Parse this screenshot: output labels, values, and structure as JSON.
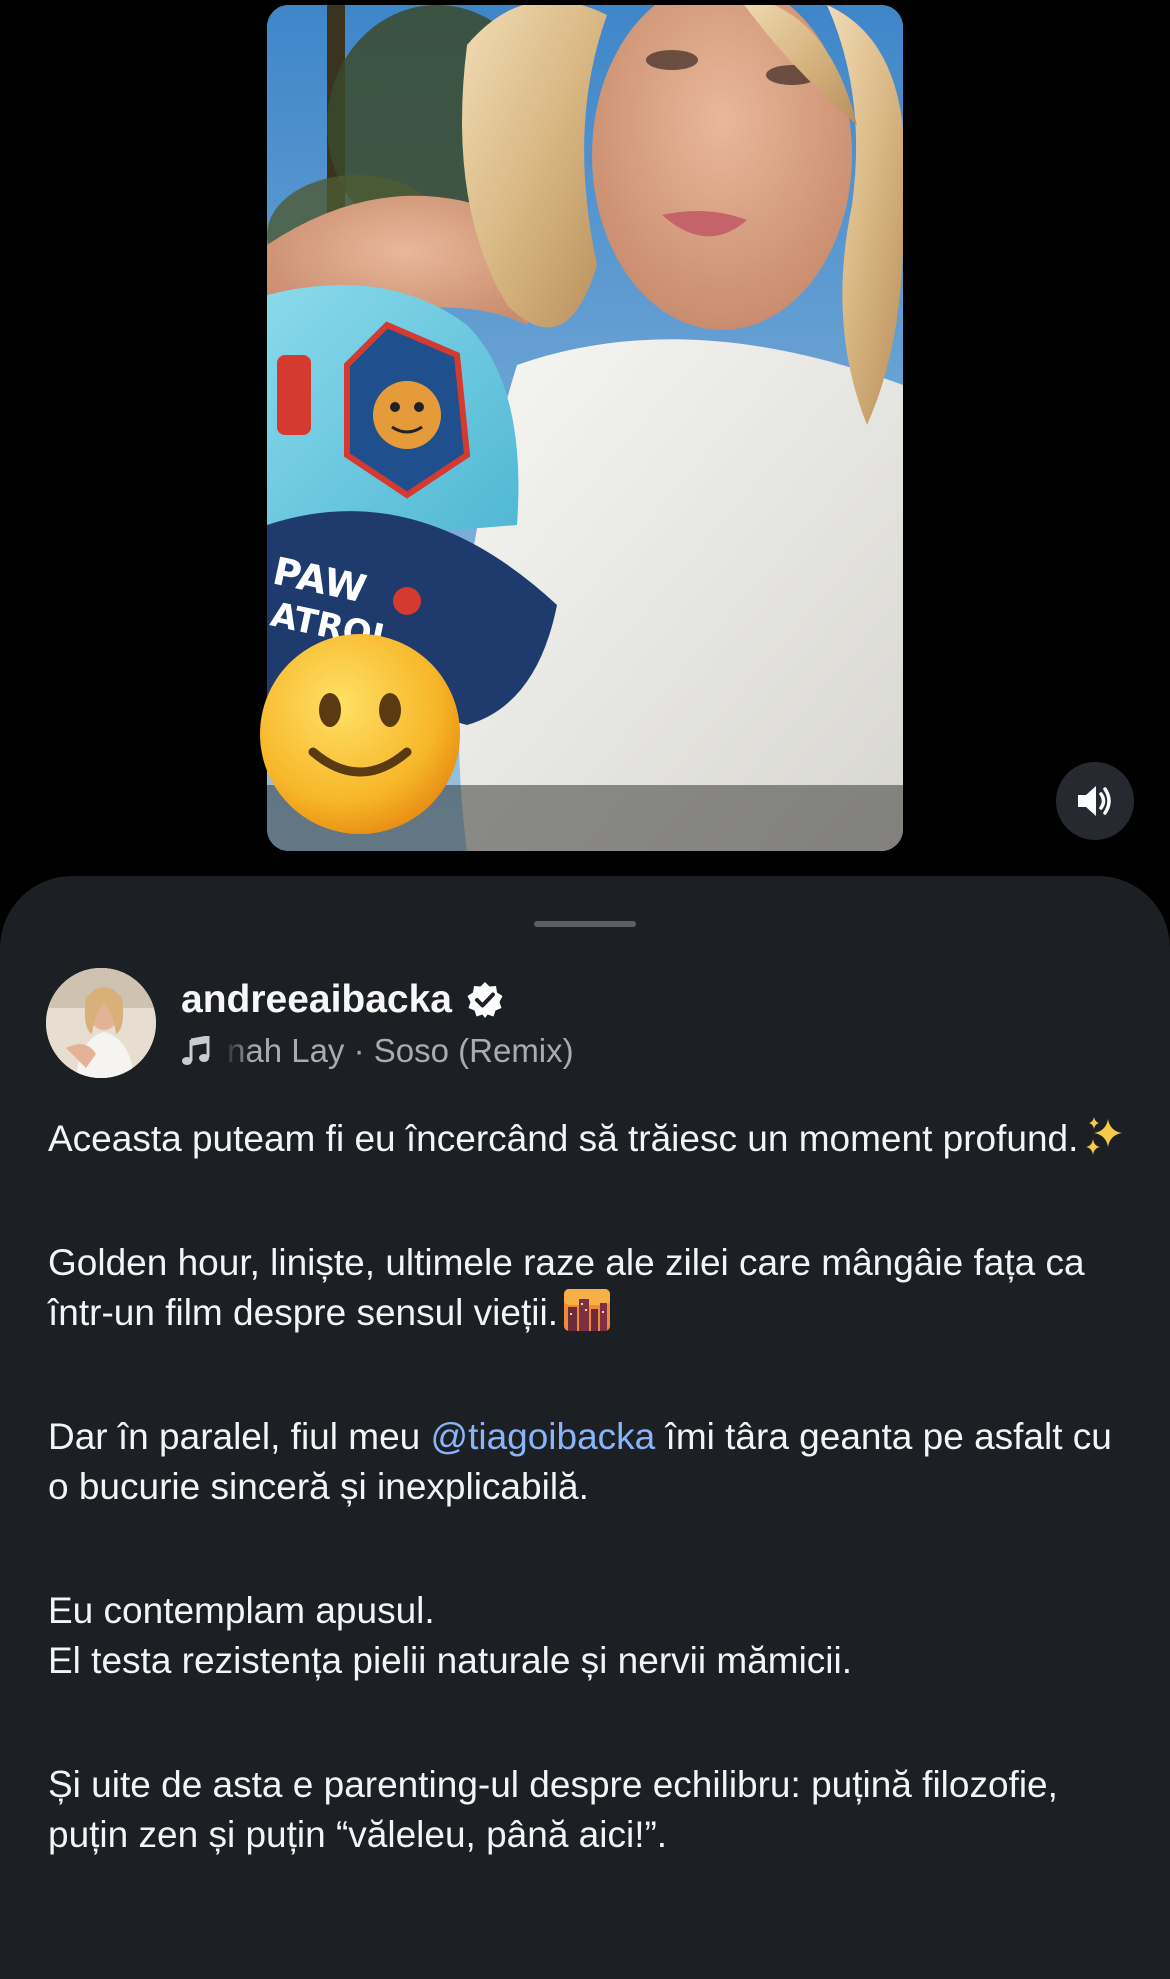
{
  "post": {
    "author": {
      "username": "andreeaibacka",
      "verified": true
    },
    "music": {
      "track": "nah Lay · Soso (Remix)"
    },
    "caption": {
      "p1": "Aceasta puteam fi eu încercând să trăiesc un moment profund.",
      "p2": "Golden hour, liniște, ultimele raze ale zilei care mângâie fața ca într-un film despre sensul vieții.",
      "p3_before": "Dar în paralel, fiul meu ",
      "p3_mention": "@tiagoibacka",
      "p3_after": " îmi târa geanta pe asfalt cu o bucurie sinceră și inexplicabilă.",
      "p4_line1": "Eu contemplam apusul.",
      "p4_line2": "El testa rezistența pielii naturale și nervii mămicii.",
      "p5": "Și uite de asta e parenting-ul despre echilibru: puțină filozofie, puțin zen și puțin “văleleu, până aici!”."
    }
  },
  "icons": {
    "mute": "speaker-icon",
    "music": "music-note-icon",
    "verified": "verified-badge-icon",
    "sparkles": "sparkles-icon",
    "sunset": "city-sunset-icon",
    "sticker": "slightly-smiling-face-icon"
  },
  "colors": {
    "background": "#000000",
    "sheet": "#1c1f24",
    "mention": "#8ab4f8",
    "secondary_text": "#a7abb2"
  }
}
